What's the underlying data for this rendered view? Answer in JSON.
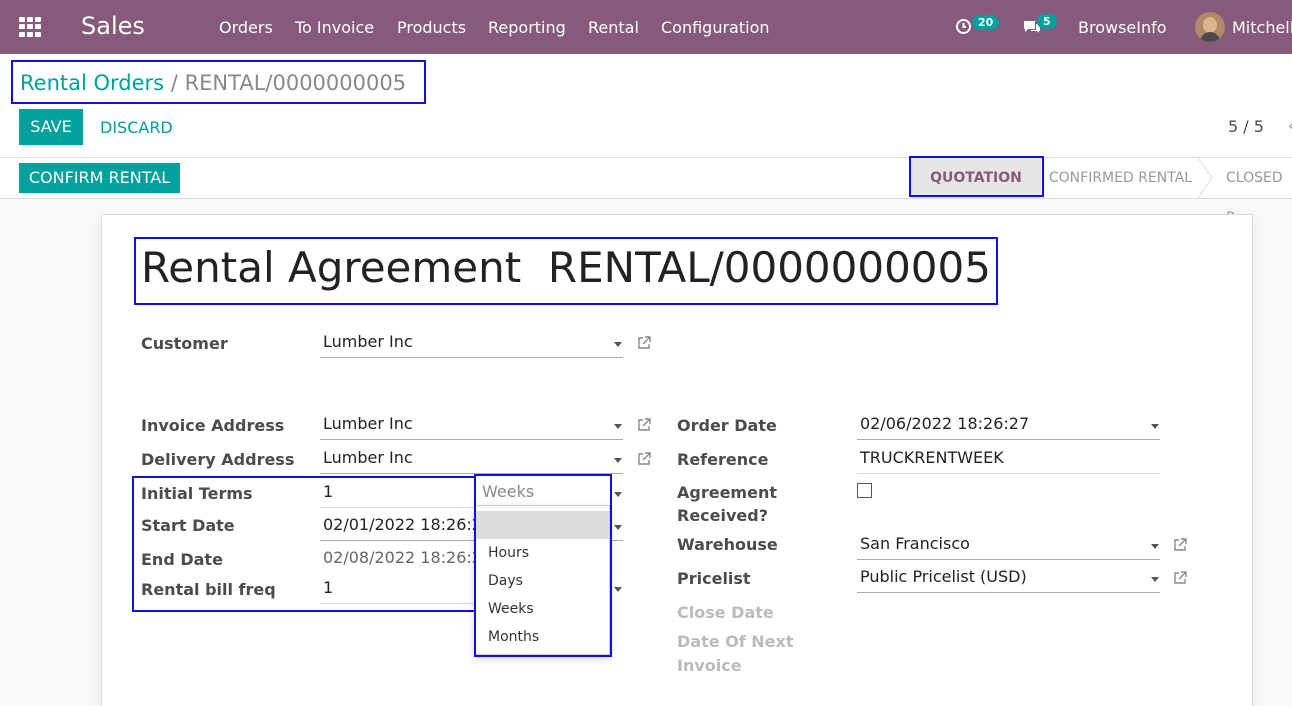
{
  "navbar": {
    "app_name": "Sales",
    "menu": [
      "Orders",
      "To Invoice",
      "Products",
      "Reporting",
      "Rental",
      "Configuration"
    ],
    "activity_count": "20",
    "message_count": "5",
    "company": "BrowseInfo",
    "user": "Mitchell"
  },
  "breadcrumb": {
    "parent": "Rental Orders",
    "separator": "/",
    "current": "RENTAL/0000000005"
  },
  "buttons": {
    "save": "SAVE",
    "discard": "DISCARD",
    "confirm": "CONFIRM RENTAL"
  },
  "pager": "5 / 5",
  "stages": [
    "QUOTATION",
    "CONFIRMED RENTAL",
    "CLOSED R"
  ],
  "form": {
    "title": "Rental Agreement  RENTAL/0000000005",
    "customer": {
      "label": "Customer",
      "value": "Lumber Inc"
    },
    "invoice_address": {
      "label": "Invoice Address",
      "value": "Lumber Inc"
    },
    "delivery_address": {
      "label": "Delivery Address",
      "value": "Lumber Inc"
    },
    "initial_terms": {
      "label": "Initial Terms",
      "value": "1",
      "unit_placeholder": "Weeks"
    },
    "start_date": {
      "label": "Start Date",
      "value": "02/01/2022 18:26:2"
    },
    "end_date": {
      "label": "End Date",
      "value": "02/08/2022 18:26:2"
    },
    "rental_bill_freq": {
      "label": "Rental bill freq",
      "value": "1"
    },
    "order_date": {
      "label": "Order Date",
      "value": "02/06/2022 18:26:27"
    },
    "reference": {
      "label": "Reference",
      "value": "TRUCKRENTWEEK"
    },
    "agreement_received": {
      "label_line1": "Agreement",
      "label_line2": "Received?",
      "checked": false
    },
    "warehouse": {
      "label": "Warehouse",
      "value": "San Francisco"
    },
    "pricelist": {
      "label": "Pricelist",
      "value": "Public Pricelist (USD)"
    },
    "close_date": {
      "label": "Close Date"
    },
    "next_invoice": {
      "label_line1": "Date Of Next",
      "label_line2": "Invoice"
    }
  },
  "unit_options": [
    "Hours",
    "Days",
    "Weeks",
    "Months"
  ],
  "colors": {
    "navbar": "#875a7b",
    "accent": "#00a09d",
    "highlight": "#1010d8"
  }
}
